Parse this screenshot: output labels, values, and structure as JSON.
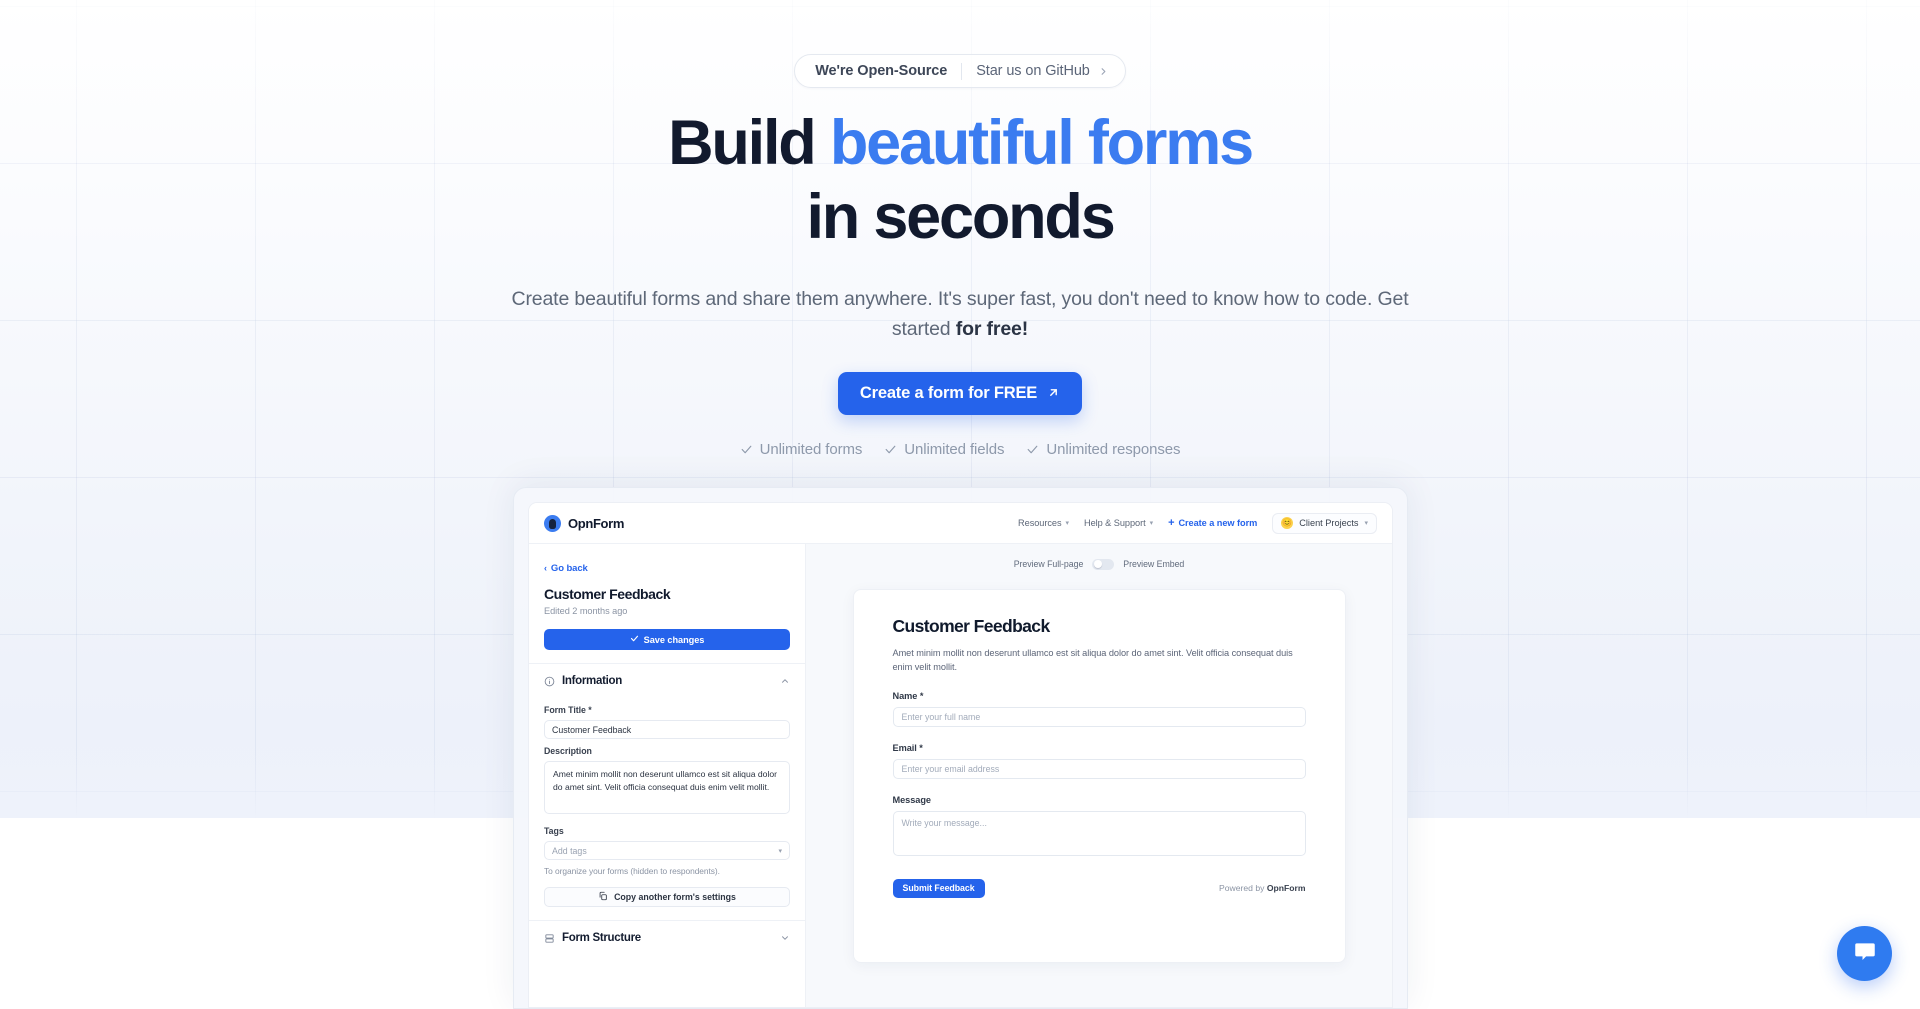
{
  "hero": {
    "badge": {
      "strong": "We're Open-Source",
      "link": "Star us on GitHub",
      "chevron_icon": "chevron-right-icon"
    },
    "headline": {
      "line1_lead": "Build ",
      "line1_accent": "beautiful forms",
      "line2": "in seconds"
    },
    "subhead": {
      "part1": "Create beautiful forms and share them anywhere. It's super fast, you don't need to know how to code. Get started ",
      "bold": "for free!"
    },
    "cta": {
      "label": "Create a form for FREE",
      "arrow_icon": "arrow-up-right-icon"
    },
    "features": [
      {
        "icon": "check-icon",
        "label": "Unlimited forms"
      },
      {
        "icon": "check-icon",
        "label": "Unlimited fields"
      },
      {
        "icon": "check-icon",
        "label": "Unlimited responses"
      }
    ]
  },
  "app": {
    "nav": {
      "brand": "OpnForm",
      "brand_icon": "opnform-logo-icon",
      "resources": "Resources",
      "help": "Help & Support",
      "create": "Create a new form",
      "workspace": "Client Projects",
      "workspace_avatar": "😊"
    },
    "sidebar": {
      "go_back": "Go back",
      "form_title": "Customer Feedback",
      "edited": "Edited 2 months ago",
      "save": "Save changes",
      "information_section": {
        "title": "Information",
        "icon": "info-icon",
        "chevron": "chevron-up-icon"
      },
      "form_title_label": "Form Title",
      "form_title_required": "*",
      "form_title_value": "Customer Feedback",
      "description_label": "Description",
      "description_value": "Amet minim mollit non deserunt ullamco est sit aliqua dolor do amet sint. Velit officia consequat duis enim velit mollit.",
      "tags_label": "Tags",
      "tags_placeholder": "Add tags",
      "tags_hint": "To organize your forms (hidden to respondents).",
      "copy_settings": "Copy another form's settings",
      "copy_icon": "copy-icon",
      "form_structure_section": {
        "title": "Form Structure",
        "icon": "layout-rows-icon",
        "chevron": "chevron-down-icon"
      }
    },
    "preview": {
      "toolbar": {
        "full_page": "Preview Full-page",
        "embed": "Preview Embed",
        "toggle_state": "off"
      },
      "form": {
        "title": "Customer Feedback",
        "description": "Amet minim mollit non deserunt ullamco est sit aliqua dolor do amet sint. Velit officia consequat duis enim velit mollit.",
        "fields": [
          {
            "label": "Name",
            "required": "*",
            "placeholder": "Enter your full name",
            "type": "input"
          },
          {
            "label": "Email",
            "required": "*",
            "placeholder": "Enter your email address",
            "type": "input"
          },
          {
            "label": "Message",
            "required": "",
            "placeholder": "Write your message...",
            "type": "textarea"
          }
        ],
        "submit": "Submit Feedback",
        "powered_prefix": "Powered by ",
        "powered_brand": "OpnForm"
      }
    }
  },
  "chat": {
    "icon": "chat-bubble-icon"
  },
  "colors": {
    "accent_blue": "#2563eb",
    "headline_accent": "#3b7cf0",
    "headline_dark": "#121a2e",
    "muted_text": "#5e6878",
    "chat_fab": "#2f7bf0"
  }
}
